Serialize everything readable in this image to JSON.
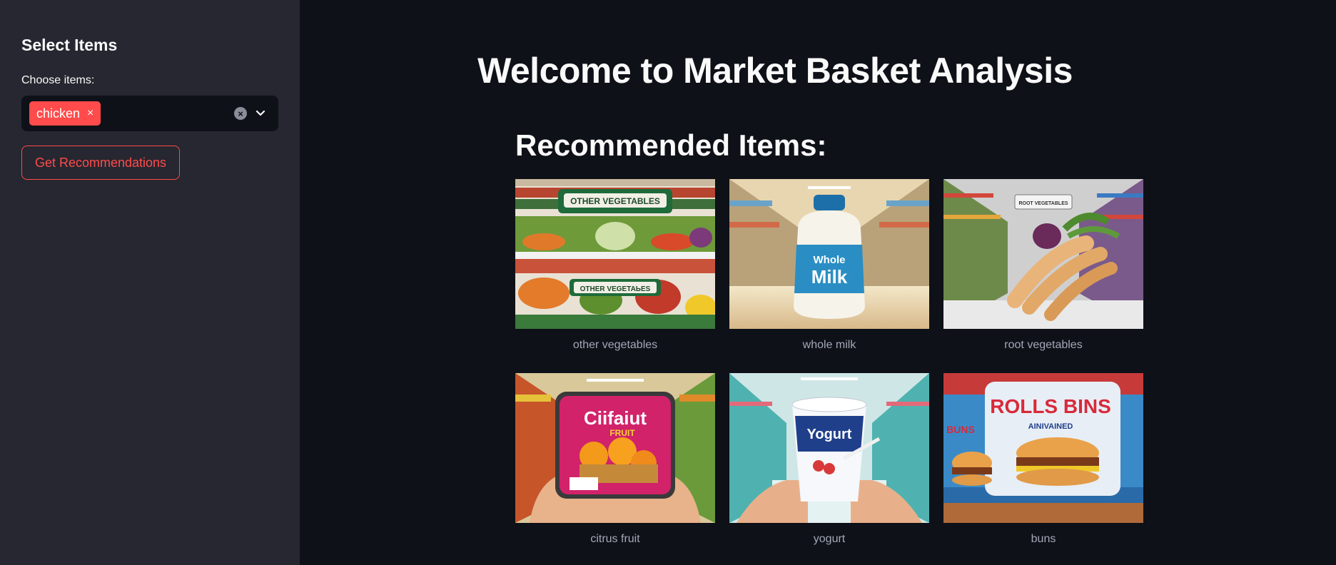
{
  "sidebar": {
    "title": "Select Items",
    "choose_label": "Choose items:",
    "selected_items": [
      "chicken"
    ],
    "chip_remove_icon": "×",
    "clear_icon": "×",
    "button_label": "Get Recommendations"
  },
  "main": {
    "title": "Welcome to Market Basket Analysis",
    "recommended_heading": "Recommended Items:",
    "items": [
      {
        "caption": "other vegetables",
        "image_text_1": "OTHER VEGETABLES",
        "image_text_2": "OTHER VEGETAЬES"
      },
      {
        "caption": "whole milk",
        "image_text_1": "Whole",
        "image_text_2": "Milk"
      },
      {
        "caption": "root vegetables",
        "image_text_1": "ROOT VEGETABLES"
      },
      {
        "caption": "citrus fruit",
        "image_text_1": "Ciifaiut",
        "image_text_2": "FRUIT"
      },
      {
        "caption": "yogurt",
        "image_text_1": "Yogurt"
      },
      {
        "caption": "buns",
        "image_text_1": "ROLLS BINS",
        "image_text_2": "AINIVAINED",
        "image_text_3": "BUNS"
      }
    ]
  },
  "colors": {
    "background": "#0e1117",
    "sidebar": "#262730",
    "accent": "#ff4b4b",
    "text": "#fafafa",
    "caption": "#a3a8b8"
  }
}
